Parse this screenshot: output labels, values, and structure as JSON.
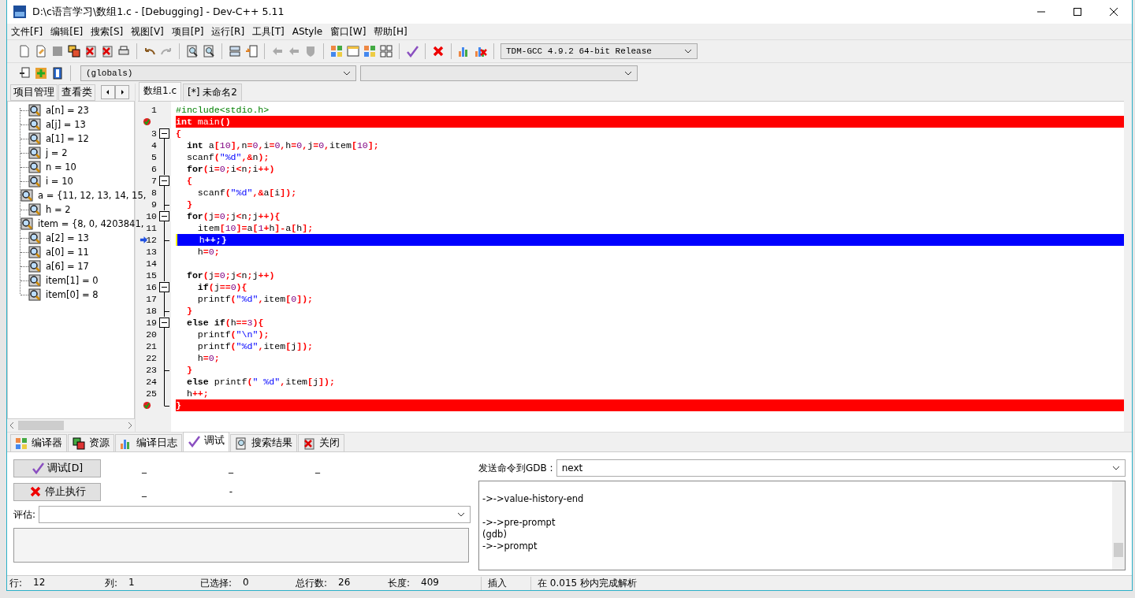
{
  "window": {
    "title": "D:\\c语言学习\\数组1.c - [Debugging] - Dev-C++ 5.11"
  },
  "menu": [
    "文件[F]",
    "编辑[E]",
    "搜索[S]",
    "视图[V]",
    "项目[P]",
    "运行[R]",
    "工具[T]",
    "AStyle",
    "窗口[W]",
    "帮助[H]"
  ],
  "compiler_select": {
    "value": "TDM-GCC 4.9.2 64-bit Release"
  },
  "scope_select": {
    "value": "(globals)"
  },
  "side_tabs": [
    "项目管理",
    "查看类"
  ],
  "watch": [
    "a[n] = 23",
    "a[j] = 13",
    "a[1] = 12",
    "j = 2",
    "n = 10",
    "i = 10",
    "a = {11, 12, 13, 14, 15,",
    "h = 2",
    "item = {8, 0, 4203841,",
    "a[2] = 13",
    "a[0] = 11",
    "a[6] = 17",
    "item[1] = 0",
    "item[0] = 8"
  ],
  "editor_tabs": [
    {
      "label": "数组1.c",
      "selected": true
    },
    {
      "label": "[*] 未命名2",
      "selected": false
    }
  ],
  "code": [
    {
      "num": "1",
      "text": "#include<stdio.h>",
      "kind": "normal",
      "in_fold": false,
      "fold_start": false,
      "fold_end": false
    },
    {
      "text": "int main()",
      "kind": "breakpoint",
      "in_fold": false,
      "fold_start": false,
      "fold_end": false
    },
    {
      "num": "3",
      "text": "{",
      "kind": "normal",
      "in_fold": true,
      "fold_start": true,
      "fold_end": false
    },
    {
      "num": "4",
      "text": "  int a[10],n=0,i=0,h=0,j=0,item[10];",
      "kind": "normal",
      "in_fold": true,
      "fold_start": false,
      "fold_end": false
    },
    {
      "num": "5",
      "text": "  scanf(\"%d\",&n);",
      "kind": "normal",
      "in_fold": true,
      "fold_start": false,
      "fold_end": false
    },
    {
      "num": "6",
      "text": "  for(i=0;i<n;i++)",
      "kind": "normal",
      "in_fold": true,
      "fold_start": false,
      "fold_end": false
    },
    {
      "num": "7",
      "text": "  {",
      "kind": "normal",
      "in_fold": true,
      "fold_start": true,
      "fold_end": false
    },
    {
      "num": "8",
      "text": "    scanf(\"%d\",&a[i]);",
      "kind": "normal",
      "in_fold": true,
      "fold_start": false,
      "fold_end": false
    },
    {
      "num": "9",
      "text": "  }",
      "kind": "normal",
      "in_fold": true,
      "fold_start": false,
      "fold_end": true
    },
    {
      "num": "10",
      "text": "  for(j=0;j<n;j++){",
      "kind": "normal",
      "in_fold": true,
      "fold_start": true,
      "fold_end": false
    },
    {
      "num": "11",
      "text": "    item[10]=a[1+h]-a[h];",
      "kind": "normal",
      "in_fold": true,
      "fold_start": false,
      "fold_end": false
    },
    {
      "num": "12",
      "text": "    h++;}",
      "kind": "current",
      "in_fold": true,
      "fold_start": false,
      "fold_end": true
    },
    {
      "num": "13",
      "text": "    h=0;",
      "kind": "normal",
      "in_fold": true,
      "fold_start": false,
      "fold_end": false
    },
    {
      "num": "14",
      "kind": "normal",
      "in_fold": true,
      "fold_start": false,
      "fold_end": false
    },
    {
      "num": "15",
      "text": "  for(j=0;j<n;j++)",
      "kind": "normal",
      "in_fold": true,
      "fold_start": false,
      "fold_end": false
    },
    {
      "num": "16",
      "text": "    if(j==0){",
      "kind": "normal",
      "in_fold": true,
      "fold_start": true,
      "fold_end": false
    },
    {
      "num": "17",
      "text": "    printf(\"%d\",item[0]);",
      "kind": "normal",
      "in_fold": true,
      "fold_start": false,
      "fold_end": false
    },
    {
      "num": "18",
      "text": "  }",
      "kind": "normal",
      "in_fold": true,
      "fold_start": false,
      "fold_end": true
    },
    {
      "num": "19",
      "text": "  else if(h==3){",
      "kind": "normal",
      "in_fold": true,
      "fold_start": true,
      "fold_end": false
    },
    {
      "num": "20",
      "text": "    printf(\"\\n\");",
      "kind": "normal",
      "in_fold": true,
      "fold_start": false,
      "fold_end": false
    },
    {
      "num": "21",
      "text": "    printf(\"%d\",item[j]);",
      "kind": "normal",
      "in_fold": true,
      "fold_start": false,
      "fold_end": false
    },
    {
      "num": "22",
      "text": "    h=0;",
      "kind": "normal",
      "in_fold": true,
      "fold_start": false,
      "fold_end": false
    },
    {
      "num": "23",
      "text": "  }",
      "kind": "normal",
      "in_fold": true,
      "fold_start": false,
      "fold_end": true
    },
    {
      "num": "24",
      "text": "  else printf(\" %d\",item[j]);",
      "kind": "normal",
      "in_fold": true,
      "fold_start": false,
      "fold_end": false
    },
    {
      "num": "25",
      "text": "  h++;",
      "kind": "normal",
      "in_fold": true,
      "fold_start": false,
      "fold_end": false
    },
    {
      "text": "}",
      "kind": "breakpoint",
      "in_fold": true,
      "fold_start": false,
      "fold_end": true
    }
  ],
  "bottom_tabs": [
    {
      "label": "编译器",
      "selected": false
    },
    {
      "label": "资源",
      "selected": false
    },
    {
      "label": "编译日志",
      "selected": false
    },
    {
      "label": "调试",
      "selected": true
    },
    {
      "label": "搜索结果",
      "selected": false
    },
    {
      "label": "关闭",
      "selected": false
    }
  ],
  "debug": {
    "buttons": [
      "调试[D]",
      "停止执行"
    ],
    "marks_row1": [
      "_",
      "_",
      "_"
    ],
    "marks_row2": [
      "_",
      "-"
    ],
    "evaluate_label": "评估:",
    "gdb_label": "发送命令到GDB :",
    "gdb_command": "next",
    "gdb_output": "->->value-history-end\n\n->->pre-prompt\n(gdb)\n->->prompt"
  },
  "status_bar": [
    {
      "label": "行:",
      "value": "12"
    },
    {
      "label": "列:",
      "value": "1"
    },
    {
      "label": "已选择:",
      "value": "0"
    },
    {
      "label": "总行数:",
      "value": "26"
    },
    {
      "label": "长度:",
      "value": "409"
    },
    {
      "label": "插入"
    },
    {
      "label": "在 0.015 秒内完成解析"
    }
  ]
}
